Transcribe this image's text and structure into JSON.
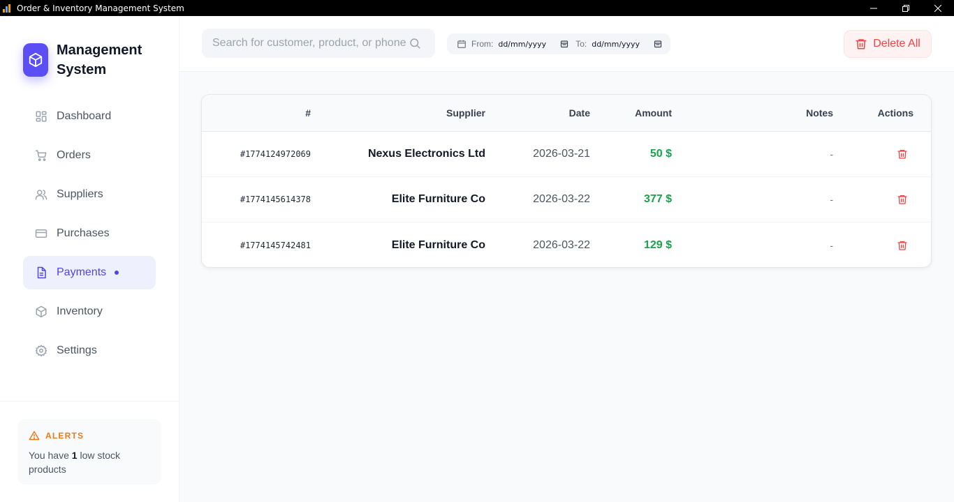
{
  "window": {
    "title": "Order & Inventory Management System"
  },
  "brand": {
    "name": "Management System"
  },
  "nav": {
    "items": [
      {
        "label": "Dashboard",
        "icon": "dashboard-icon"
      },
      {
        "label": "Orders",
        "icon": "cart-icon"
      },
      {
        "label": "Suppliers",
        "icon": "users-icon"
      },
      {
        "label": "Purchases",
        "icon": "credit-card-icon"
      },
      {
        "label": "Payments",
        "icon": "document-icon"
      },
      {
        "label": "Inventory",
        "icon": "box-icon"
      },
      {
        "label": "Settings",
        "icon": "gear-icon"
      }
    ],
    "active": "Payments"
  },
  "alerts": {
    "title": "ALERTS",
    "prefix": "You have ",
    "count": "1",
    "suffix": " low stock products"
  },
  "search": {
    "placeholder": "Search for customer, product, or phone",
    "value": ""
  },
  "date_filter": {
    "from_label": "From:",
    "from_value": "dd/mm/yyyy",
    "to_label": "To:",
    "to_value": "dd/mm/yyyy"
  },
  "toolbar": {
    "delete_all_label": "Delete All"
  },
  "table": {
    "headers": {
      "id": "#",
      "supplier": "Supplier",
      "date": "Date",
      "amount": "Amount",
      "notes": "Notes",
      "actions": "Actions"
    },
    "rows": [
      {
        "id": "#1774124972069",
        "supplier": "Nexus Electronics Ltd",
        "date": "2026-03-21",
        "amount": "50 $",
        "notes": "-"
      },
      {
        "id": "#1774145614378",
        "supplier": "Elite Furniture Co",
        "date": "2026-03-22",
        "amount": "377 $",
        "notes": "-"
      },
      {
        "id": "#1774145742481",
        "supplier": "Elite Furniture Co",
        "date": "2026-03-22",
        "amount": "129 $",
        "notes": "-"
      }
    ]
  },
  "colors": {
    "accent": "#4f46e5",
    "brand": "#5b4ef5",
    "danger": "#ef4444",
    "success": "#16a34a",
    "warning": "#ea7a1a"
  }
}
